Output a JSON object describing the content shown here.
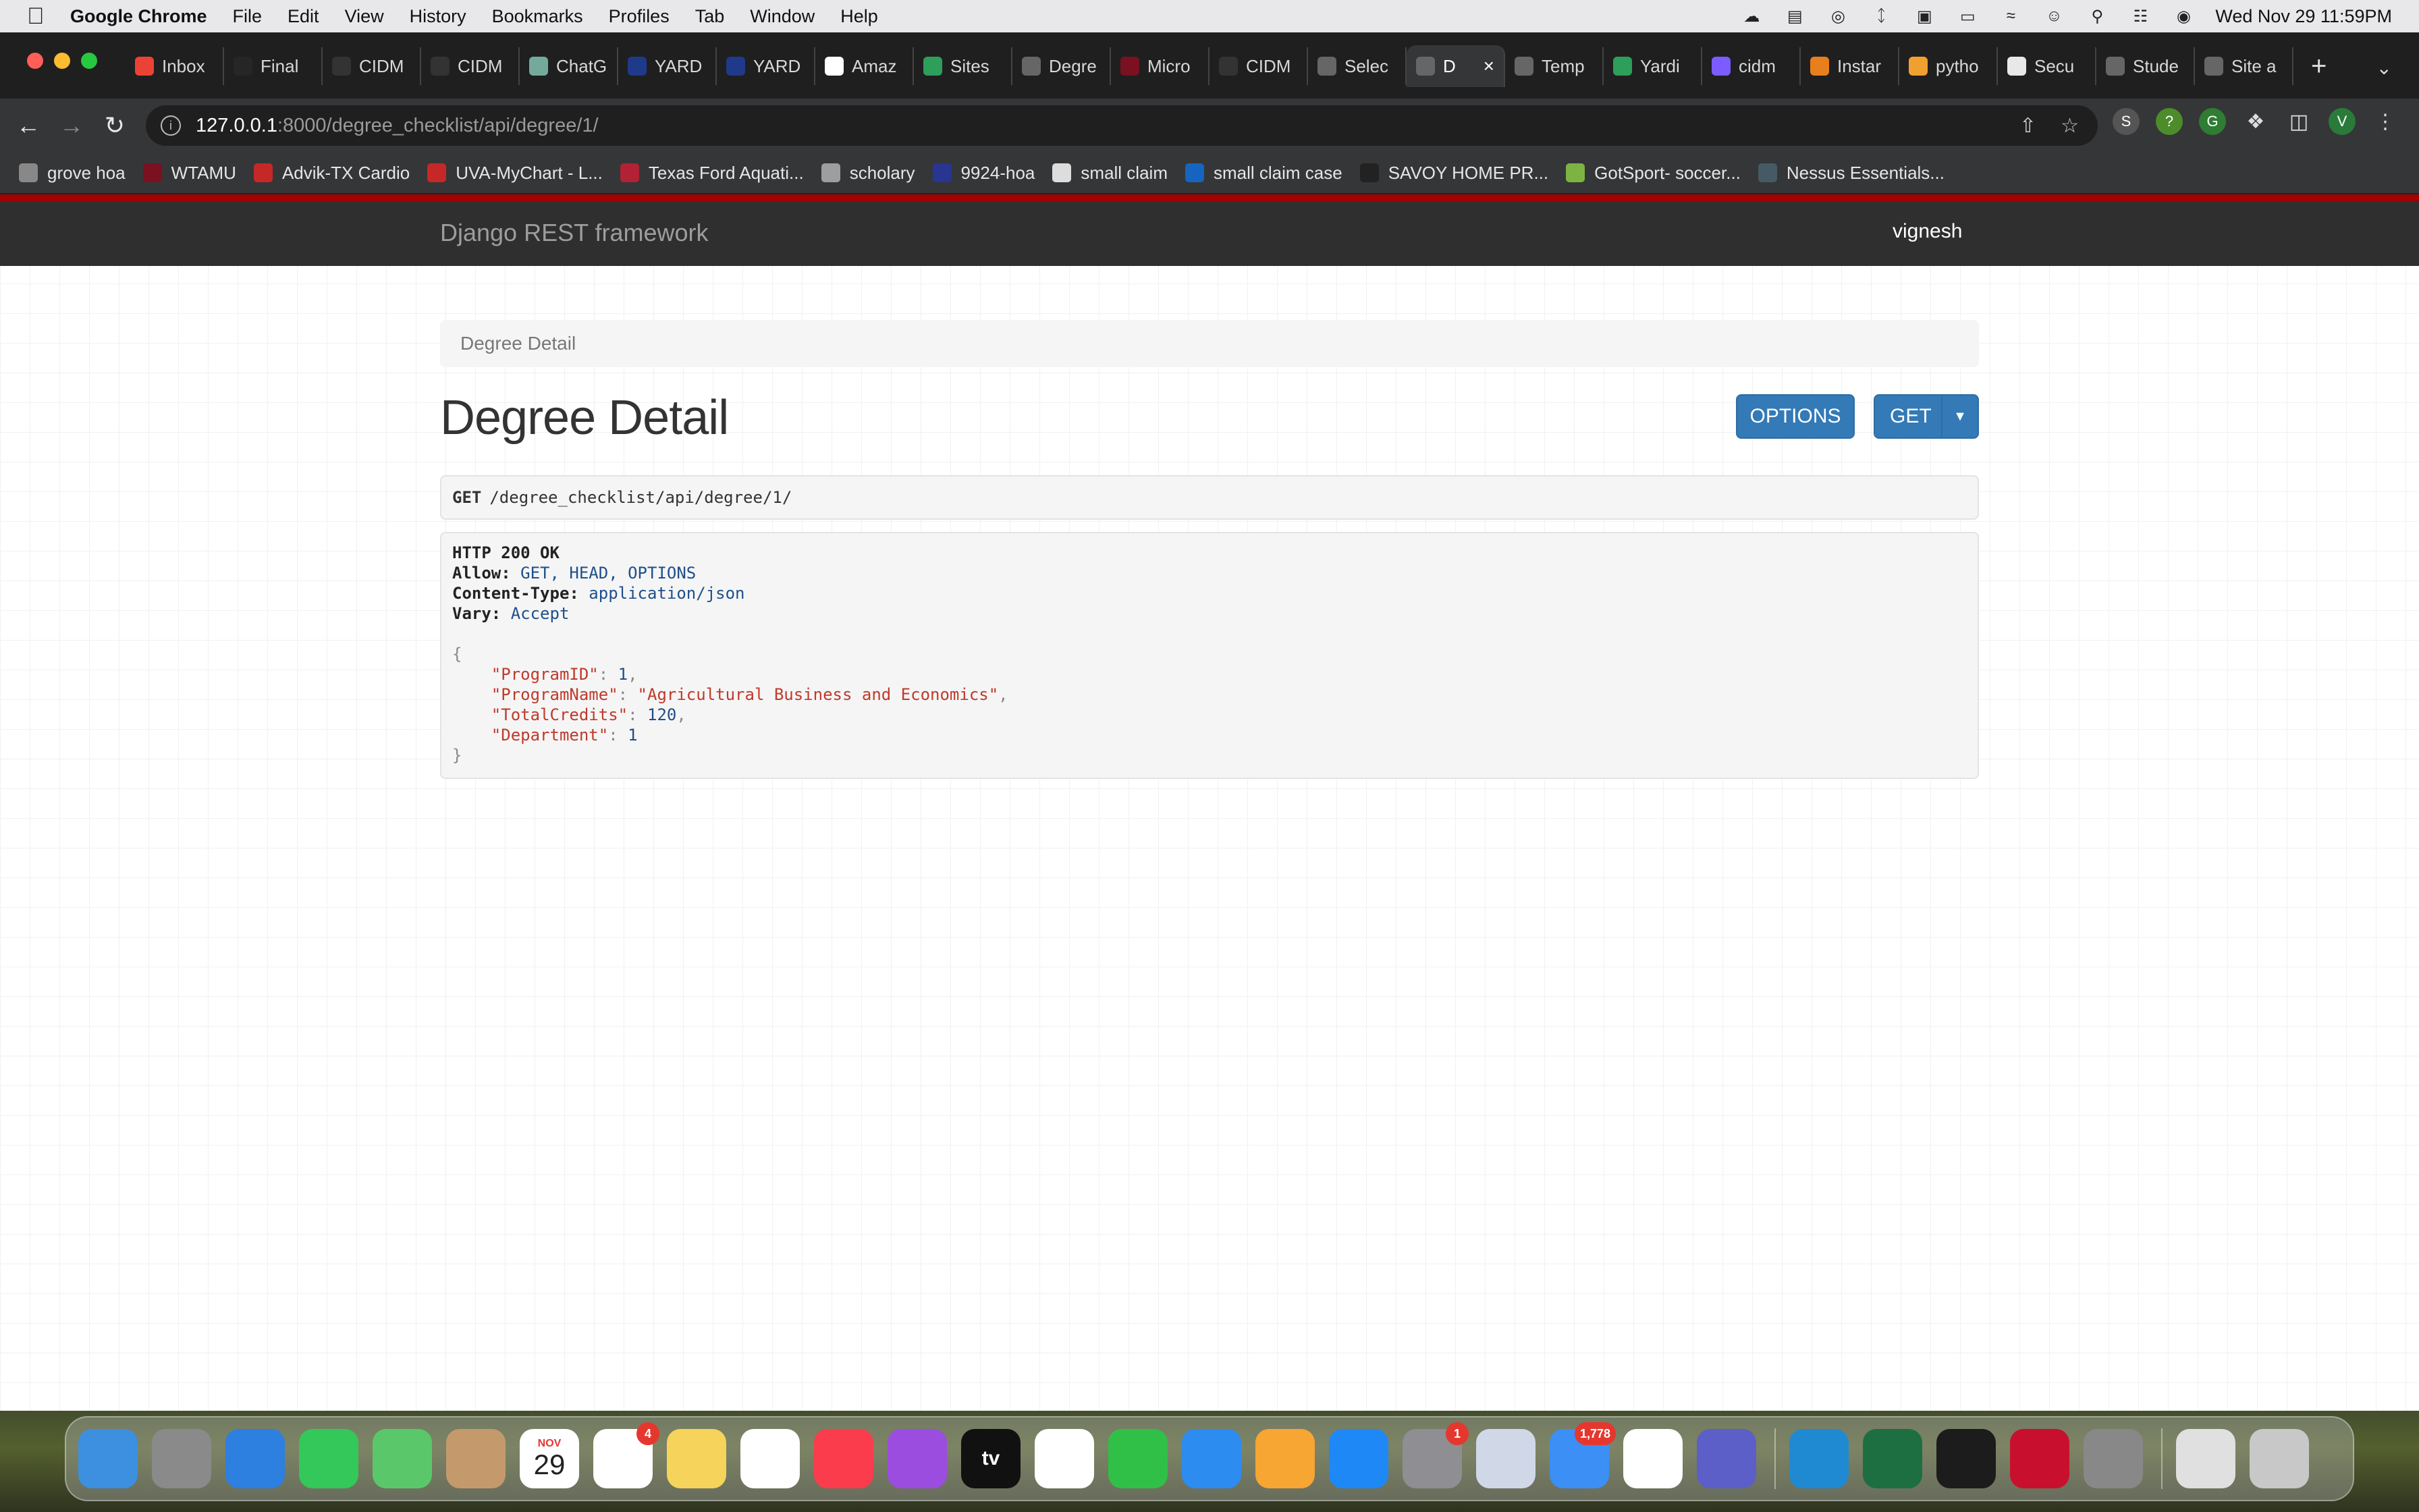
{
  "menubar": {
    "app_name": "Google Chrome",
    "items": [
      "File",
      "Edit",
      "View",
      "History",
      "Bookmarks",
      "Profiles",
      "Tab",
      "Window",
      "Help"
    ],
    "clock": "Wed Nov 29  11:59PM"
  },
  "tabs": [
    {
      "label": "Inbox",
      "icon": "gmail-icon",
      "color": "#ea4335"
    },
    {
      "label": "Final",
      "icon": "blackboard-icon",
      "color": "#262626"
    },
    {
      "label": "CIDM",
      "icon": "github-icon",
      "color": "#333333"
    },
    {
      "label": "CIDM",
      "icon": "github-icon",
      "color": "#333333"
    },
    {
      "label": "ChatG",
      "icon": "chatgpt-icon",
      "color": "#74aa9c"
    },
    {
      "label": "YARD",
      "icon": "yard-icon",
      "color": "#1f3a8a"
    },
    {
      "label": "YARD",
      "icon": "yard-icon",
      "color": "#1f3a8a"
    },
    {
      "label": "Amaz",
      "icon": "amazon-icon",
      "color": "#ffffff"
    },
    {
      "label": "Sites",
      "icon": "sites-icon",
      "color": "#2e9e5b"
    },
    {
      "label": "Degre",
      "icon": "globe-icon",
      "color": "#666666"
    },
    {
      "label": "Micro",
      "icon": "wt-icon",
      "color": "#7a1020"
    },
    {
      "label": "CIDM",
      "icon": "github-icon",
      "color": "#333333"
    },
    {
      "label": "Selec",
      "icon": "globe-icon",
      "color": "#666666"
    },
    {
      "label": "D",
      "icon": "globe-icon",
      "color": "#666666",
      "active": true
    },
    {
      "label": "Temp",
      "icon": "globe-icon",
      "color": "#666666"
    },
    {
      "label": "Yardi",
      "icon": "yardi-icon",
      "color": "#2e9e5b"
    },
    {
      "label": "cidm",
      "icon": "cidm-icon",
      "color": "#7c5cff"
    },
    {
      "label": "Instar",
      "icon": "instar-icon",
      "color": "#e87e1c"
    },
    {
      "label": "pytho",
      "icon": "python-icon",
      "color": "#f0a030"
    },
    {
      "label": "Secu",
      "icon": "puzzle-icon",
      "color": "#e8e8e8"
    },
    {
      "label": "Stude",
      "icon": "globe-icon",
      "color": "#666666"
    },
    {
      "label": "Site a",
      "icon": "globe-icon",
      "color": "#666666"
    }
  ],
  "address": {
    "host": "127.0.0.1",
    "rest": ":8000/degree_checklist/api/degree/1/"
  },
  "profile_initial": "V",
  "bookmarks": [
    {
      "label": "grove hoa",
      "icon": "globe-icon",
      "color": "#888888"
    },
    {
      "label": "WTAMU",
      "icon": "wt-icon",
      "color": "#7a1020"
    },
    {
      "label": "Advik-TX Cardio",
      "icon": "advik-icon",
      "color": "#c62828"
    },
    {
      "label": "UVA-MyChart - L...",
      "icon": "mychart-icon",
      "color": "#c62828"
    },
    {
      "label": "Texas Ford Aquati...",
      "icon": "flag-icon",
      "color": "#b22234"
    },
    {
      "label": "scholary",
      "icon": "folder-icon",
      "color": "#9e9e9e"
    },
    {
      "label": "9924-hoa",
      "icon": "hoa-icon",
      "color": "#283593"
    },
    {
      "label": "small claim",
      "icon": "doc-icon",
      "color": "#dddddd"
    },
    {
      "label": "small claim case",
      "icon": "texas-icon",
      "color": "#1565c0"
    },
    {
      "label": "SAVOY HOME PR...",
      "icon": "savoy-icon",
      "color": "#222222"
    },
    {
      "label": "GotSport- soccer...",
      "icon": "gotsport-icon",
      "color": "#7cb342"
    },
    {
      "label": "Nessus Essentials...",
      "icon": "nessus-icon",
      "color": "#455a64"
    }
  ],
  "drf": {
    "brand": "Django REST framework",
    "user": "vignesh",
    "breadcrumb": "Degree Detail",
    "title": "Degree Detail",
    "options_label": "OPTIONS",
    "get_label": "GET",
    "request_method": "GET",
    "request_path": "/degree_checklist/api/degree/1/",
    "status_line": "HTTP 200 OK",
    "headers": [
      {
        "name": "Allow:",
        "value": "GET, HEAD, OPTIONS"
      },
      {
        "name": "Content-Type:",
        "value": "application/json"
      },
      {
        "name": "Vary:",
        "value": "Accept"
      }
    ],
    "json_fields": [
      {
        "key": "\"ProgramID\"",
        "value": "1",
        "type": "num"
      },
      {
        "key": "\"ProgramName\"",
        "value": "\"Agricultural Business and Economics\"",
        "type": "str"
      },
      {
        "key": "\"TotalCredits\"",
        "value": "120",
        "type": "num"
      },
      {
        "key": "\"Department\"",
        "value": "1",
        "type": "num"
      }
    ]
  },
  "dock": {
    "apps": [
      {
        "name": "finder-icon",
        "color": "#3d8fe0"
      },
      {
        "name": "launchpad-icon",
        "color": "#8a8a8a"
      },
      {
        "name": "safari-icon",
        "color": "#2d7fe0"
      },
      {
        "name": "facetime-icon",
        "color": "#34c759"
      },
      {
        "name": "maps-icon",
        "color": "#5ac86a"
      },
      {
        "name": "contacts-icon",
        "color": "#c49a6c"
      },
      {
        "name": "calendar-icon",
        "color": "#ffffff",
        "month": "NOV",
        "day": "29"
      },
      {
        "name": "reminders-icon",
        "color": "#ffffff",
        "badge": "4"
      },
      {
        "name": "notes-icon",
        "color": "#f6d35b"
      },
      {
        "name": "freeform-icon",
        "color": "#ffffff"
      },
      {
        "name": "music-icon",
        "color": "#fa3c4c"
      },
      {
        "name": "podcasts-icon",
        "color": "#9b4de0"
      },
      {
        "name": "tv-icon",
        "color": "#111111",
        "label": "tv"
      },
      {
        "name": "news-icon",
        "color": "#ffffff"
      },
      {
        "name": "numbers-icon",
        "color": "#30c048"
      },
      {
        "name": "keynote-icon",
        "color": "#2d8cf0"
      },
      {
        "name": "pages-icon",
        "color": "#f7a533"
      },
      {
        "name": "appstore-icon",
        "color": "#1e88f7"
      },
      {
        "name": "system-settings-icon",
        "color": "#8e8e93",
        "badge": "1"
      },
      {
        "name": "preview-icon",
        "color": "#d0d8e8"
      },
      {
        "name": "mail-icon",
        "color": "#3b8ff5",
        "badge": "1,778"
      },
      {
        "name": "chrome-icon",
        "color": "#ffffff"
      },
      {
        "name": "teams-icon",
        "color": "#5b5fc7"
      },
      {
        "name": "vscode-icon",
        "color": "#1f8ad2"
      },
      {
        "name": "excel-icon",
        "color": "#1d6f42"
      },
      {
        "name": "terminal-icon",
        "color": "#1c1c1c"
      },
      {
        "name": "acrobat-icon",
        "color": "#c8102e"
      },
      {
        "name": "keychain-icon",
        "color": "#888888"
      }
    ],
    "right": [
      {
        "name": "archive-icon",
        "color": "#e0e0e0"
      },
      {
        "name": "trash-icon",
        "color": "#c8c8c8"
      }
    ]
  }
}
